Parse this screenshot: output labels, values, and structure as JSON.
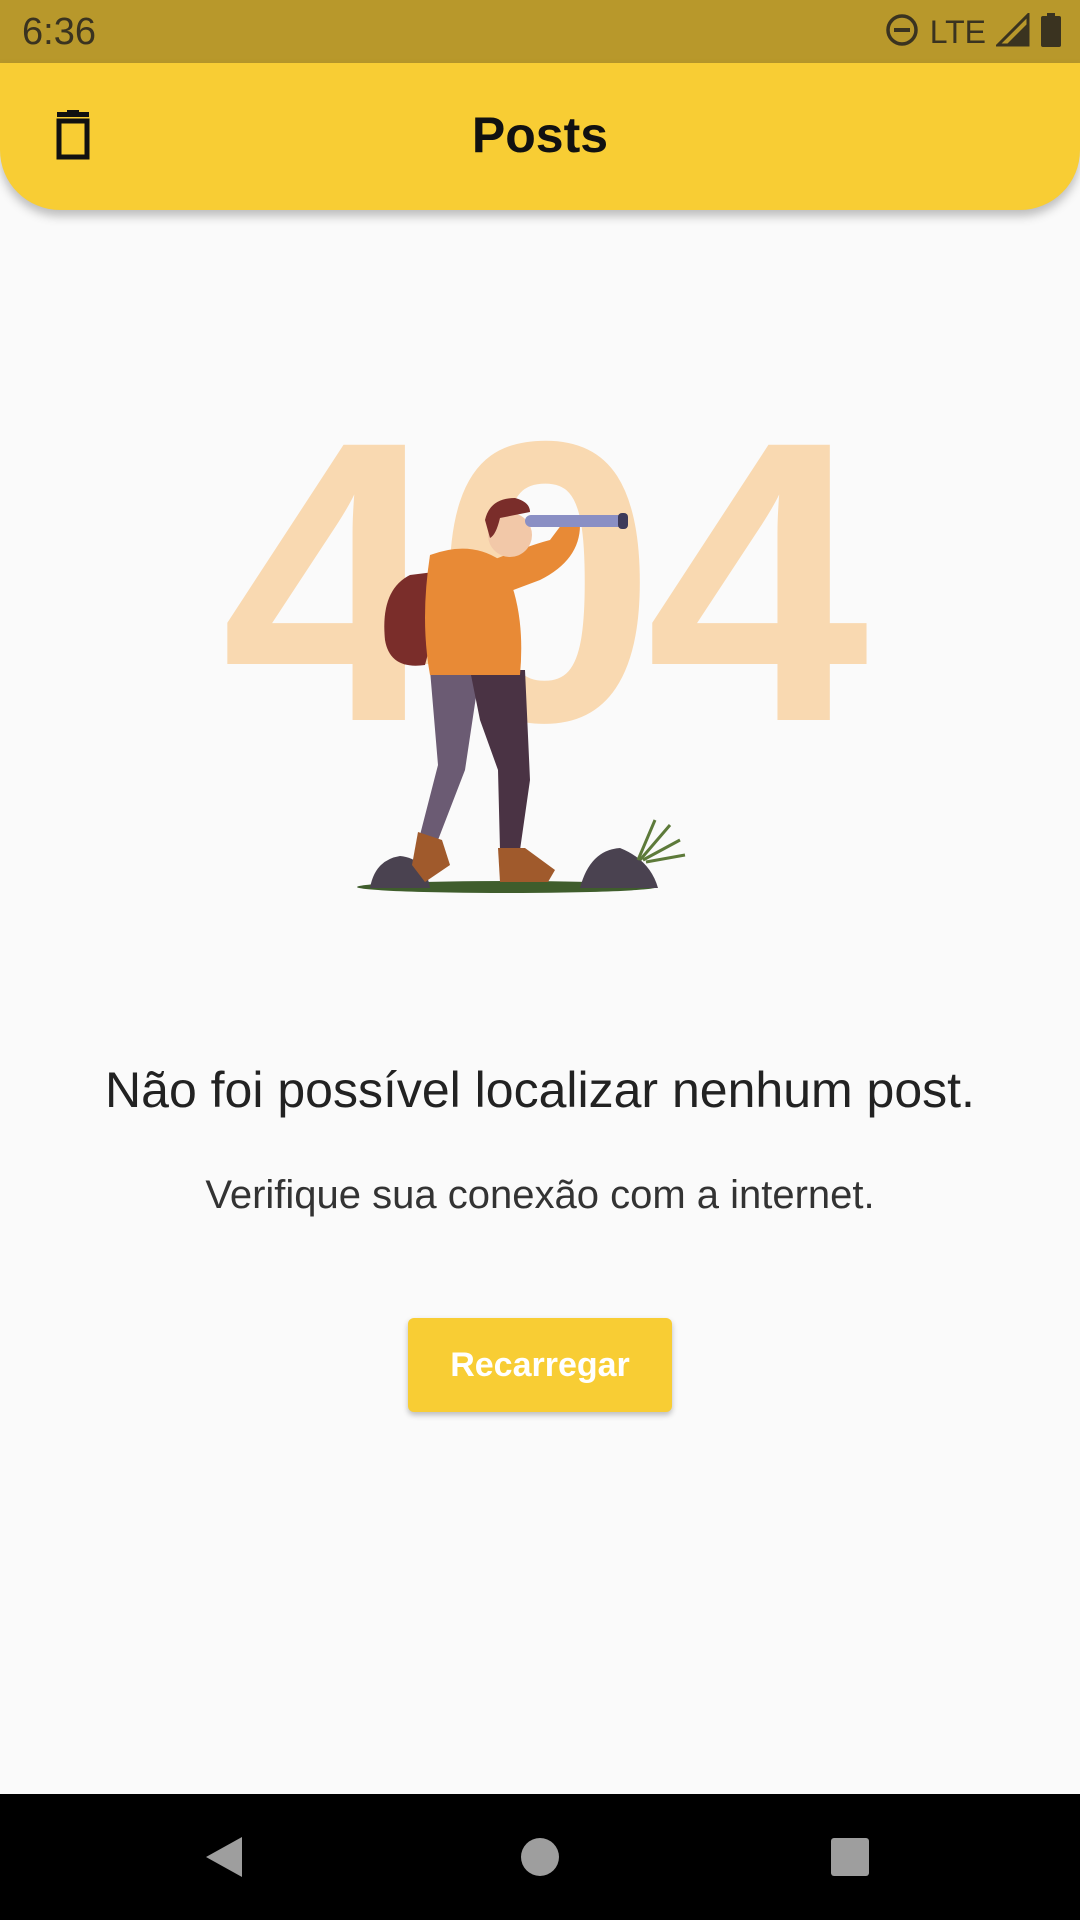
{
  "status_bar": {
    "time": "6:36",
    "network": "LTE"
  },
  "app_bar": {
    "title": "Posts",
    "bg_color": "#f8cd34"
  },
  "illustration": {
    "code_text": "404"
  },
  "empty_state": {
    "title": "Não foi possível localizar nenhum post.",
    "subtitle": "Verifique sua conexão com a internet.",
    "reload_label": "Recarregar"
  },
  "icons": {
    "status": [
      "do-not-disturb-icon",
      "signal-icon",
      "battery-icon"
    ],
    "app_bar": "trash-icon",
    "nav": [
      "back-icon",
      "home-icon",
      "recents-icon"
    ]
  }
}
